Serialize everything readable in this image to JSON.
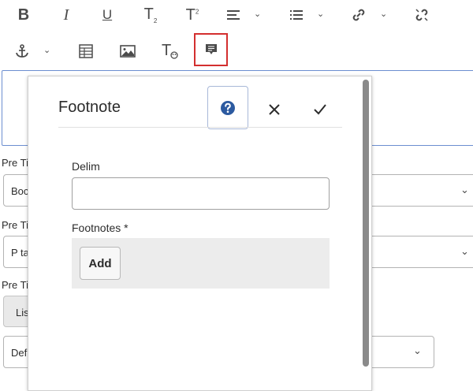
{
  "toolbar": {
    "row1": [
      {
        "name": "bold-icon",
        "glyph": "B"
      },
      {
        "name": "italic-icon",
        "glyph": "I"
      },
      {
        "name": "underline-icon",
        "glyph": "U"
      },
      {
        "name": "subscript-icon",
        "glyph": "T"
      },
      {
        "name": "superscript-icon",
        "glyph": "T"
      },
      {
        "name": "paragraph-format-icon"
      },
      {
        "name": "list-icon"
      },
      {
        "name": "link-icon"
      },
      {
        "name": "unlink-icon"
      }
    ],
    "row2": [
      {
        "name": "anchor-icon"
      },
      {
        "name": "table-icon"
      },
      {
        "name": "image-icon"
      },
      {
        "name": "text-style-icon",
        "glyph": "T"
      },
      {
        "name": "footnote-icon"
      }
    ],
    "subscript_suffix": "2",
    "superscript_suffix": "2"
  },
  "background": {
    "labels": [
      "Pre Ti",
      "Pre Ti",
      "Pre Ti"
    ],
    "selects": [
      "Boc",
      "P ta",
      "Lis",
      "Def"
    ]
  },
  "dialog": {
    "title": "Footnote",
    "delim_label": "Delim",
    "delim_value": "",
    "footnotes_label": "Footnotes *",
    "add_label": "Add"
  },
  "colors": {
    "accent_blue": "#2c5aa0",
    "highlight_red": "#d32f2f",
    "text": "#2c2c2c"
  }
}
